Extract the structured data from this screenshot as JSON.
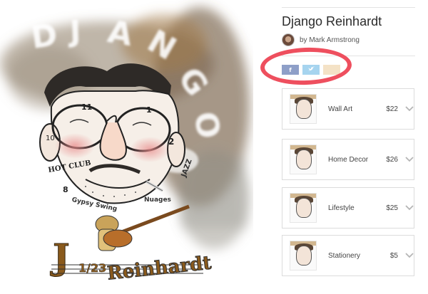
{
  "artwork": {
    "alt": "Django Reinhardt caricature",
    "lettering": {
      "arc": "DJANGO",
      "hot_club": "HOT CLUB",
      "gypsy_swing": "Gypsy Swing",
      "nuages": "Nuages",
      "jazz": "JAZZ",
      "signature_initial": "J",
      "date": "1/23",
      "surname": "Reinhardt",
      "ear_left": "10",
      "ear_right": "2",
      "num_8": "8",
      "num_11": "11",
      "num_1": "1"
    }
  },
  "product": {
    "title": "Django Reinhardt",
    "artist_prefix": "by",
    "artist": "Mark Armstrong",
    "artist_line": "by Mark Armstrong"
  },
  "share": {
    "facebook": "f",
    "twitter": "t",
    "pinterest": "p"
  },
  "products": [
    {
      "name": "Wall Art",
      "price": "$22"
    },
    {
      "name": "Home Decor",
      "price": "$26"
    },
    {
      "name": "Lifestyle",
      "price": "$25"
    },
    {
      "name": "Stationery",
      "price": "$5"
    }
  ],
  "colors": {
    "highlight": "#ee4f5e",
    "facebook": "#8e9fc8",
    "twitter": "#a6d4ef",
    "pinterest": "#f4e2c6"
  },
  "icons": {
    "chevron": "chevron-down-icon",
    "facebook": "facebook-icon",
    "twitter": "twitter-icon",
    "pinterest": "pinterest-icon"
  }
}
